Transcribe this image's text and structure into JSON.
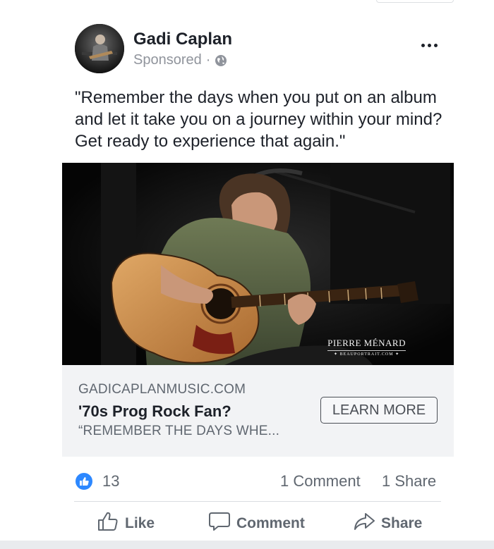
{
  "post": {
    "author": "Gadi Caplan",
    "sponsored_label": "Sponsored",
    "meta_separator": "·",
    "text": "\"Remember the days when you put on an album and let it take you on a journey within your mind? Get ready to experience that again.\""
  },
  "photo": {
    "credit_name": "PIERRE MÉNARD",
    "credit_site": "✦ BEAUPORTRAIT.COM ✦"
  },
  "link_preview": {
    "domain": "GADICAPLANMUSIC.COM",
    "headline": "'70s Prog Rock Fan?",
    "description": "“REMEMBER THE DAYS WHE...",
    "cta_label": "LEARN MORE"
  },
  "stats": {
    "like_count": "13",
    "comments": "1 Comment",
    "shares": "1 Share"
  },
  "actions": {
    "like_label": "Like",
    "comment_label": "Comment",
    "share_label": "Share"
  },
  "colors": {
    "like_blue": "#2d88ff",
    "text_primary": "#1d2129",
    "text_secondary": "#606770",
    "link_box_bg": "#f2f3f5"
  },
  "icons": [
    "globe-icon",
    "more-options-icon",
    "like-reaction-icon",
    "thumbs-up-icon",
    "comment-icon",
    "share-arrow-icon"
  ]
}
